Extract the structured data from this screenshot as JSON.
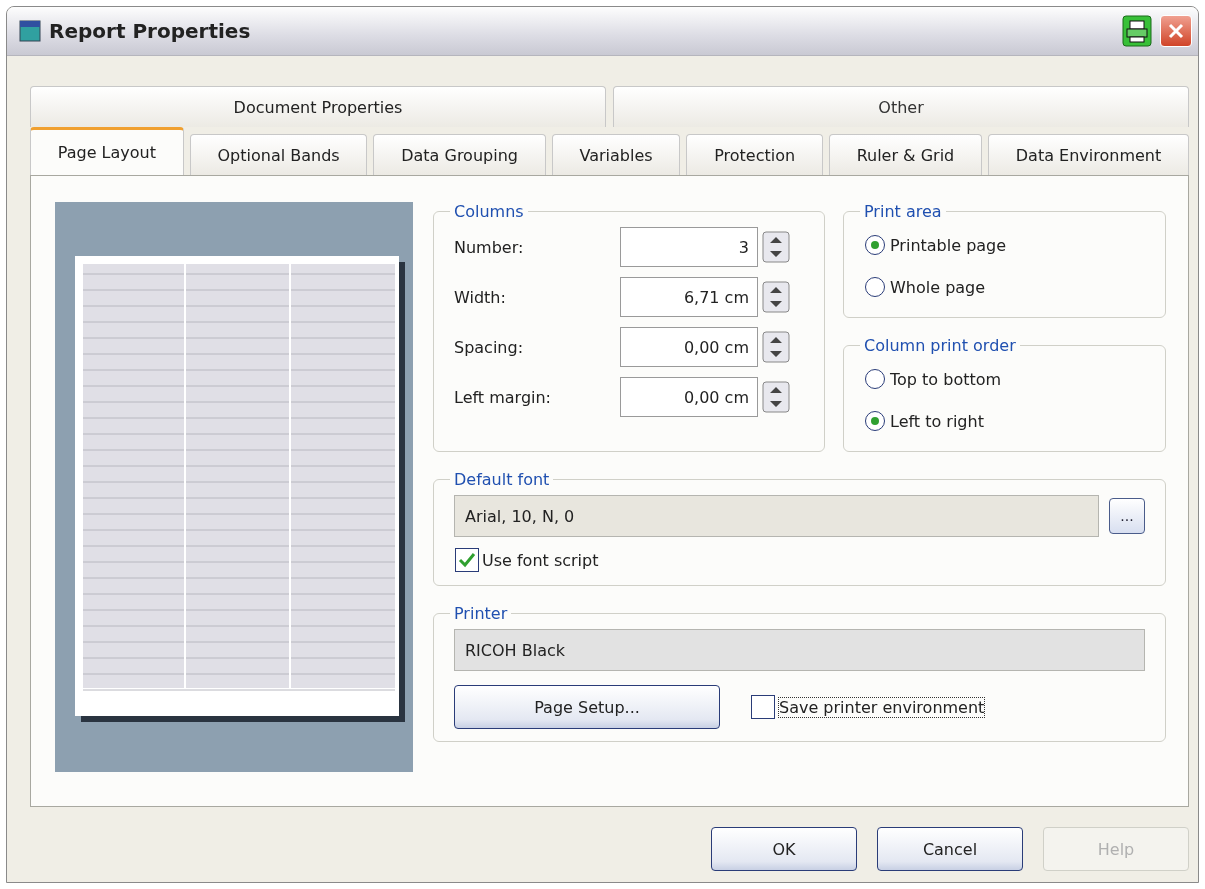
{
  "window": {
    "title": "Report Properties"
  },
  "tab_groups": [
    {
      "label": "Document Properties",
      "selected": true
    },
    {
      "label": "Other",
      "selected": false
    }
  ],
  "tabs": [
    {
      "label": "Page Layout",
      "selected": true
    },
    {
      "label": "Optional Bands",
      "selected": false
    },
    {
      "label": "Data Grouping",
      "selected": false
    },
    {
      "label": "Variables",
      "selected": false
    },
    {
      "label": "Protection",
      "selected": false
    },
    {
      "label": "Ruler & Grid",
      "selected": false
    },
    {
      "label": "Data Environment",
      "selected": false
    }
  ],
  "columns": {
    "title": "Columns",
    "fields": [
      {
        "label": "Number:",
        "value": "3"
      },
      {
        "label": "Width:",
        "value": "6,71 cm"
      },
      {
        "label": "Spacing:",
        "value": "0,00 cm"
      },
      {
        "label": "Left margin:",
        "value": "0,00 cm"
      }
    ]
  },
  "print_area": {
    "title": "Print area",
    "options": [
      {
        "label": "Printable page",
        "selected": true
      },
      {
        "label": "Whole page",
        "selected": false
      }
    ]
  },
  "column_print_order": {
    "title": "Column print order",
    "options": [
      {
        "label": "Top to bottom",
        "selected": false
      },
      {
        "label": "Left to right",
        "selected": true
      }
    ]
  },
  "default_font": {
    "title": "Default font",
    "value": "Arial, 10, N, 0",
    "browse_button": "...",
    "use_font_script": {
      "label": "Use font script",
      "checked": true
    }
  },
  "printer": {
    "title": "Printer",
    "value": "RICOH Black",
    "page_setup_button": "Page Setup...",
    "save_environment": {
      "label": "Save printer environment",
      "checked": false
    }
  },
  "buttons": [
    {
      "label": "OK",
      "disabled": false
    },
    {
      "label": "Cancel",
      "disabled": false
    },
    {
      "label": "Help",
      "disabled": true
    }
  ]
}
